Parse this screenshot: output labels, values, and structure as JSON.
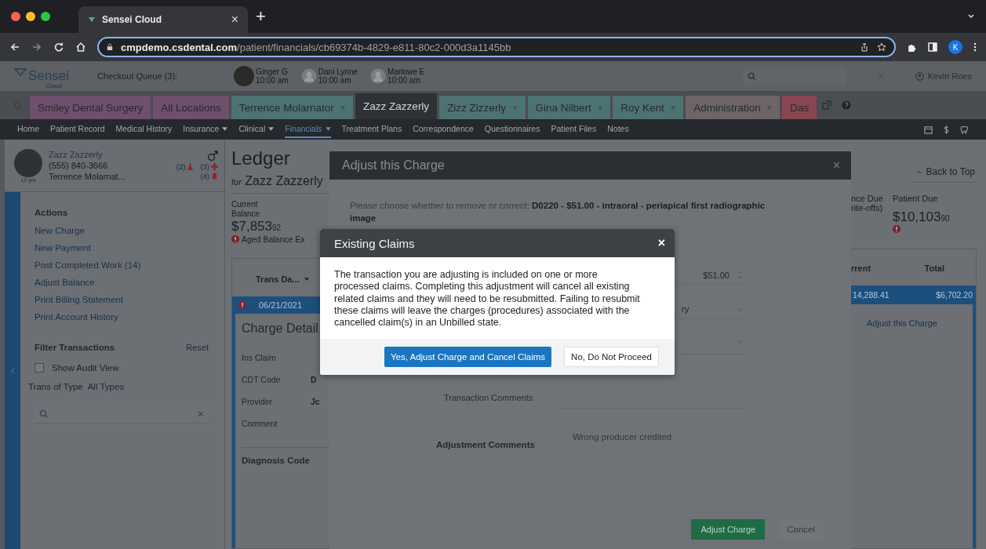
{
  "browser": {
    "tab_title": "Sensei Cloud",
    "tab_close": "×",
    "new_tab": "+",
    "url_host": "cmpdemo.csdental.com",
    "url_path": "/patient/financials/cb69374b-4829-e811-80c2-000d3a1145bb",
    "profile_initial": "K"
  },
  "header": {
    "logo": "Sensei",
    "logo_sub": "Cloud",
    "checkout_queue": "Checkout Queue (3):",
    "user": "Kevin Roes",
    "queue": [
      {
        "name": "Ginger G",
        "time": "10:00 am",
        "kind": "photo"
      },
      {
        "name": "Dani Lynne",
        "time": "10:00 am",
        "kind": "silhouette"
      },
      {
        "name": "Marlowe E",
        "time": "10:00 am",
        "kind": "silhouette"
      }
    ]
  },
  "tabs": [
    {
      "label": "Smiley Dental Surgery",
      "color": "#6e4f6c",
      "selected": false
    },
    {
      "label": "All Locations",
      "color": "#6e4f6c",
      "selected": false
    },
    {
      "label": "Terrence Molarnator",
      "color": "#4d7272",
      "selected": false,
      "close": "×"
    },
    {
      "label": "Zazz Zazzerly",
      "color": "#2e3236",
      "selected": true
    },
    {
      "label": "Zizz Zizzerly",
      "color": "#4d7272",
      "selected": false,
      "close": "×"
    },
    {
      "label": "Gina Nilbert",
      "color": "#4d7272",
      "selected": false,
      "close": "×"
    },
    {
      "label": "Roy Kent",
      "color": "#4d7272",
      "selected": false,
      "close": "×"
    },
    {
      "label": "Administration",
      "color": "#6d6468",
      "selected": false,
      "close": "×"
    },
    {
      "label": "Das",
      "color": "#8a4552",
      "selected": false
    }
  ],
  "nav": [
    {
      "label": "Home",
      "dropdown": false,
      "selected": false
    },
    {
      "label": "Patient Record",
      "dropdown": false,
      "selected": false
    },
    {
      "label": "Medical History",
      "dropdown": false,
      "selected": false
    },
    {
      "label": "Insurance",
      "dropdown": true,
      "selected": false
    },
    {
      "label": "Clinical",
      "dropdown": true,
      "selected": false
    },
    {
      "label": "Financials",
      "dropdown": true,
      "selected": true
    },
    {
      "label": "Treatment Plans",
      "dropdown": false,
      "selected": false
    },
    {
      "label": "Correspondence",
      "dropdown": false,
      "selected": false
    },
    {
      "label": "Questionnaires",
      "dropdown": false,
      "selected": false
    },
    {
      "label": "Patient Files",
      "dropdown": false,
      "selected": false
    },
    {
      "label": "Notes",
      "dropdown": false,
      "selected": false
    }
  ],
  "patient": {
    "name": "Zazz Zazzerly",
    "phone": "(555) 840-3666",
    "age": "19 yrs",
    "provider": "Terrence Molarnat...",
    "lab_count": "(2)",
    "medical_count": "(3)",
    "alert_count": "(4)"
  },
  "sidebar": {
    "actions_title": "Actions",
    "actions": [
      {
        "label": "New Charge"
      },
      {
        "label": "New Payment"
      },
      {
        "label": "Post Completed Work (14)"
      },
      {
        "label": "Adjust Balance"
      },
      {
        "label": "Print Billing Statement"
      },
      {
        "label": "Print Account History"
      }
    ],
    "filter_title": "Filter Transactions",
    "reset": "Reset",
    "audit_view": {
      "label": "Show Audit View",
      "checked": false
    },
    "type_label": "Trans of Type",
    "type_value": "All Types",
    "search_clear": "×"
  },
  "ledger": {
    "title": "Ledger",
    "for": "for",
    "patient": "Zazz Zazzerly",
    "balance_label": "Current Balance",
    "balance": "$7,853",
    "balance_cents": "92",
    "balance_alert": "Aged Balance Ex",
    "sort_column": "Trans Da...",
    "row_date": "06/21/2021",
    "details_title": "Charge Detail",
    "details": [
      {
        "label": "Ins Claim"
      },
      {
        "label": "CDT Code",
        "value": "D"
      },
      {
        "label": "Provider",
        "value": "Jc"
      },
      {
        "label": "Comment"
      }
    ],
    "diagnosis": "Diagnosis Code"
  },
  "summary": {
    "back_to_top": "Back to Top",
    "insurance_label_1": "nce Due",
    "insurance_label_2": "rite-offs)",
    "patient_due_label": "Patient Due",
    "patient_due": "$10,103",
    "patient_due_cents": "90",
    "columns": [
      "rrent",
      "Total"
    ],
    "row": [
      "14,288.41",
      "$6,702.20"
    ],
    "row_link": "Adjust this Charge"
  },
  "adjust_dialog": {
    "title": "Adjust this Charge",
    "close": "×",
    "prompt": "Please choose whether to remove or correct:  **D0220 - $51.00 - intraoral - periapical first radiographic image**",
    "amount": "$51.00",
    "select_value": "ry",
    "transaction_comments": "Transaction Comments",
    "adjustment_comments_label": "Adjustment Comments",
    "adjustment_comments": "Wrong producer credited",
    "buttons": [
      "Adjust Charge",
      "Cancel"
    ]
  },
  "claims_dialog": {
    "title": "Existing Claims",
    "close": "×",
    "message": "The transaction you are adjusting is included on one or more processed claims. Completing this adjustment will cancel all existing related claims and they will need to be resubmitted. Failing to resubmit these claims will leave the charges (procedures) associated with the cancelled claim(s) in an Unbilled state.",
    "confirm": "Yes, Adjust Charge and Cancel Claims",
    "decline": "No, Do Not Proceed"
  }
}
